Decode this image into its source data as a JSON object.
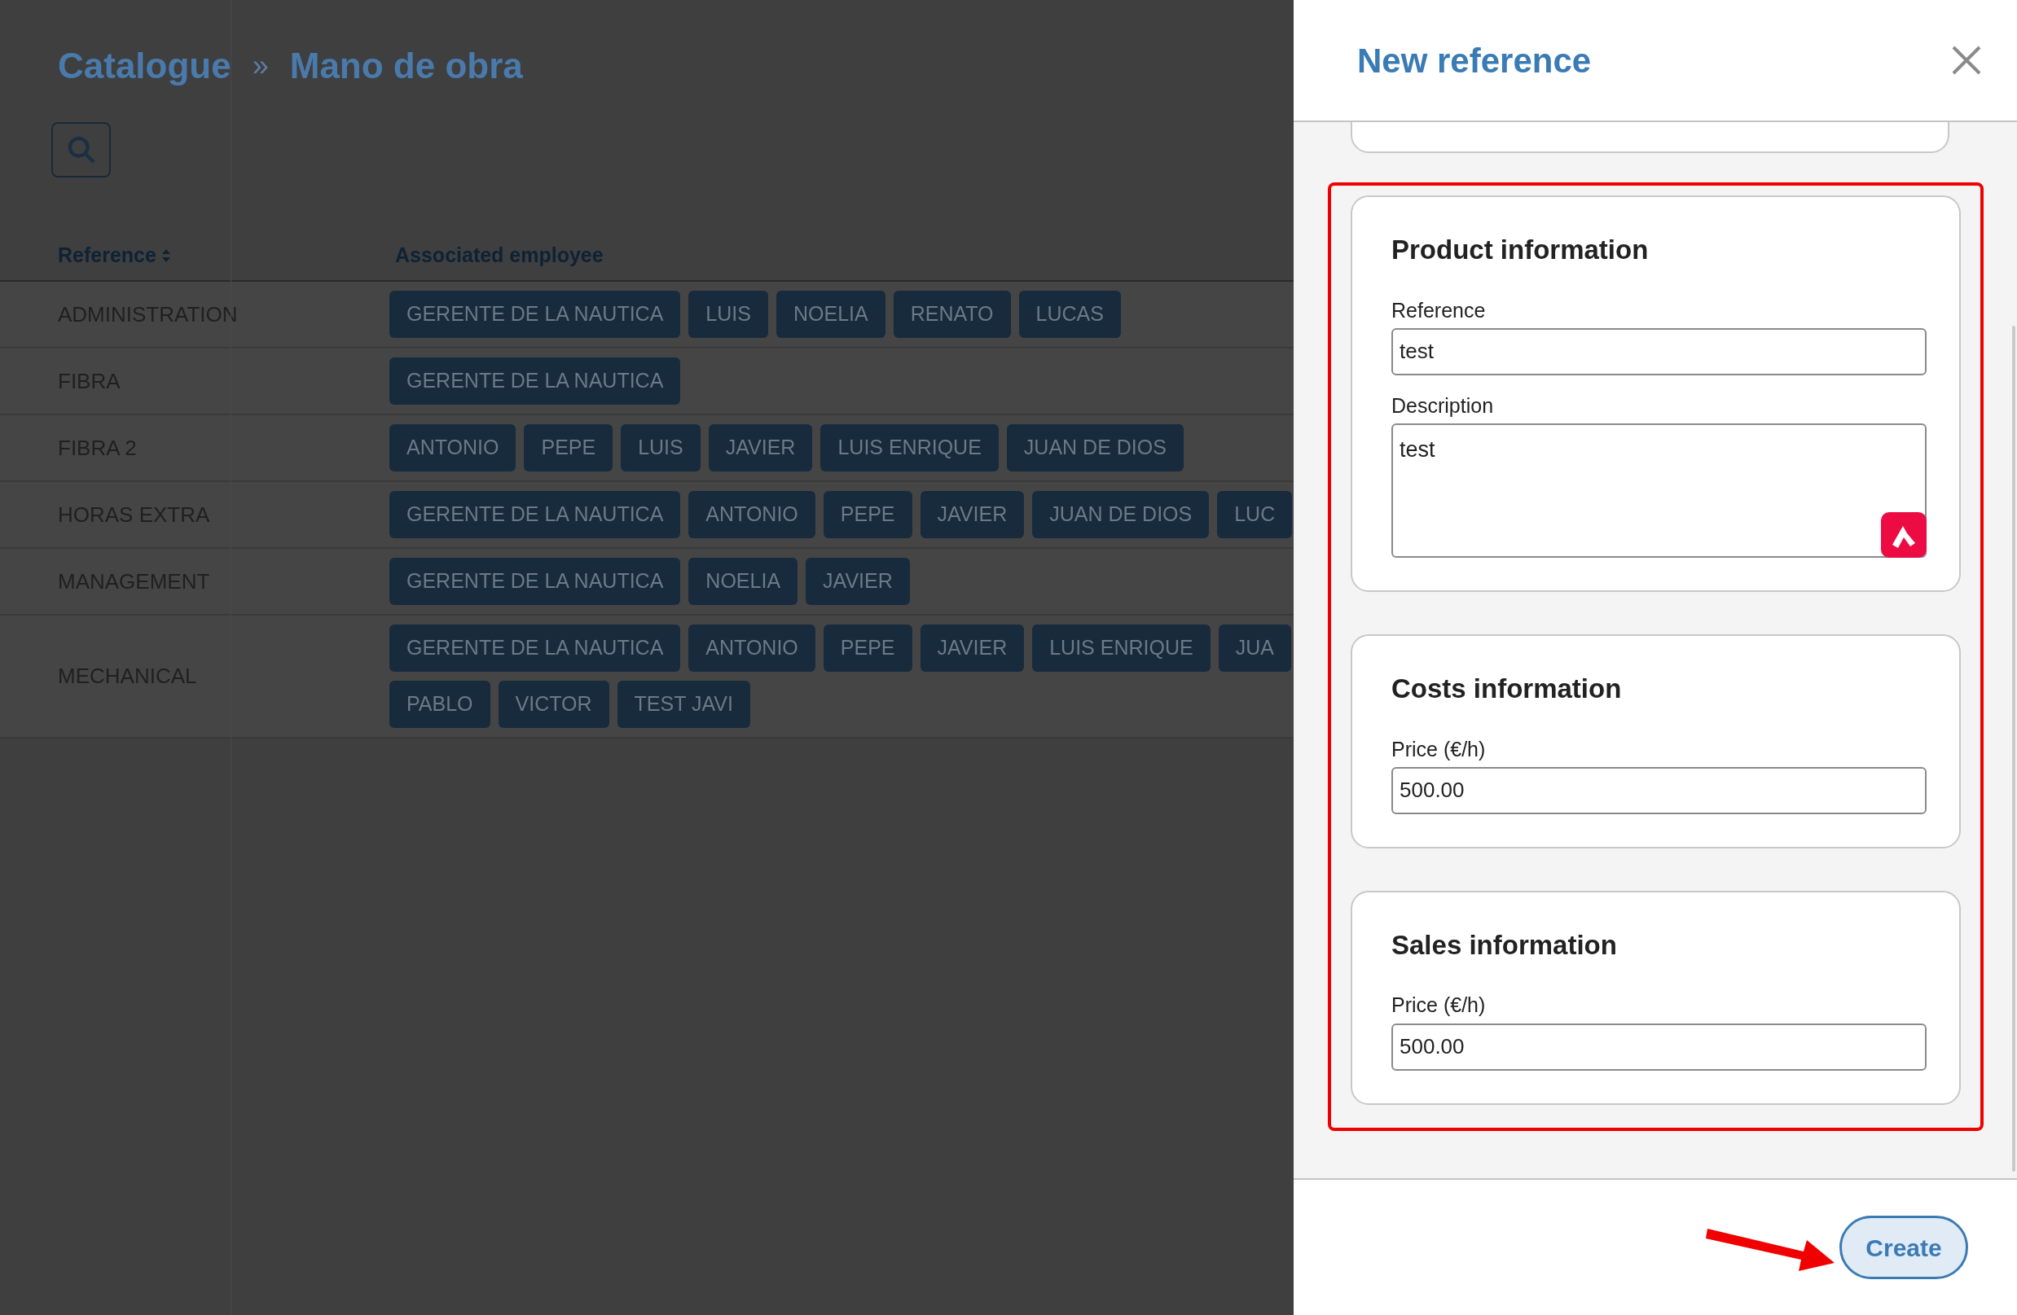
{
  "breadcrumb": {
    "items": [
      "Catalogue",
      "Mano de obra"
    ],
    "separator": "»"
  },
  "table": {
    "columns": [
      {
        "label": "Reference",
        "sortable": true
      },
      {
        "label": "Associated employee",
        "sortable": false
      }
    ],
    "rows": [
      {
        "reference": "ADMINISTRATION",
        "employees": [
          "GERENTE DE LA NAUTICA",
          "LUIS",
          "NOELIA",
          "RENATO",
          "LUCAS"
        ]
      },
      {
        "reference": "FIBRA",
        "employees": [
          "GERENTE DE LA NAUTICA"
        ]
      },
      {
        "reference": "FIBRA 2",
        "employees": [
          "ANTONIO",
          "PEPE",
          "LUIS",
          "JAVIER",
          "LUIS ENRIQUE",
          "JUAN DE DIOS"
        ]
      },
      {
        "reference": "HORAS EXTRA",
        "employees": [
          "GERENTE DE LA NAUTICA",
          "ANTONIO",
          "PEPE",
          "JAVIER",
          "JUAN DE DIOS",
          "LUC"
        ]
      },
      {
        "reference": "MANAGEMENT",
        "employees": [
          "GERENTE DE LA NAUTICA",
          "NOELIA",
          "JAVIER"
        ]
      },
      {
        "reference": "MECHANICAL",
        "employees": [
          "GERENTE DE LA NAUTICA",
          "ANTONIO",
          "PEPE",
          "JAVIER",
          "LUIS ENRIQUE",
          "JUA",
          "PABLO",
          "VICTOR",
          "TEST JAVI"
        ]
      }
    ]
  },
  "panel": {
    "title": "New reference",
    "sections": [
      {
        "title": "Product information",
        "fields": [
          {
            "label": "Reference",
            "kind": "input",
            "value": "test"
          },
          {
            "label": "Description",
            "kind": "textarea",
            "value": "test"
          }
        ]
      },
      {
        "title": "Costs information",
        "fields": [
          {
            "label": "Price (€/h)",
            "kind": "input",
            "value": "500.00"
          }
        ]
      },
      {
        "title": "Sales information",
        "fields": [
          {
            "label": "Price (€/h)",
            "kind": "input",
            "value": "500.00"
          }
        ]
      }
    ],
    "button": "Create"
  }
}
